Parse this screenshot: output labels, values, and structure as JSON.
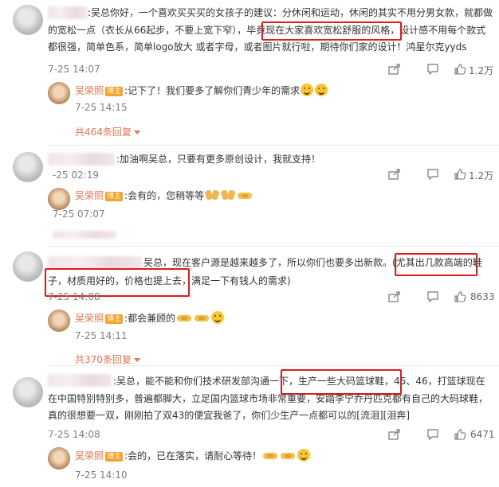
{
  "comment1": {
    "text_l1": ":吴总你好，一个喜欢买买买的女孩子的建议：分休闲和运动，休闲的其实不用分男女款，就都做",
    "text_l2a": "的宽松一点（衣长从66起步，不要上宽下窄），",
    "text_l2_hl": "毕竟现在大家喜欢宽松舒服的风格，",
    "text_l2b": "设计感不用每个款式",
    "text_l3": "都很强，简单色系，简单logo放大 或者字母，或者图片就行啦，期待你们家的设计！鸿星尔克yyds",
    "time": "7-25 14:07",
    "likes": "1.2万",
    "reply": {
      "name": "吴荣照",
      "badge": "博主",
      "text": ":记下了！我们要多了解你们青少年的需求",
      "time": "7-25 14:15"
    },
    "more": "共464条回复"
  },
  "comment2": {
    "text": ":加油啊吴总，只要有更多原创设计，我就支持！",
    "time": "-25 02:19",
    "likes": "1.2万",
    "reply": {
      "name": "吴荣照",
      "badge": "博主",
      "text": ":会有的，您稍等等",
      "time": "7-25 07:07"
    }
  },
  "comment3": {
    "text_l1a": "吴总，现在客户源是越来越多了，所以你们也要多出新款。",
    "text_l1_hl": "(尤其出几款高端的鞋",
    "text_l2_hl1": "子，",
    "text_l2_hl2": "材质用好的，价格也提上去，",
    "text_l2b": "满足一下有钱人的需求)",
    "time": "7-25 14:08",
    "likes": "8633",
    "reply": {
      "name": "吴荣照",
      "badge": "博主",
      "text": ":都会兼顾的",
      "time": "7-25 14:11"
    },
    "more": "共370条回复"
  },
  "comment4": {
    "text_l1a": ":吴总，能不能和你们技术研发部沟通一下，",
    "text_l1_hl": "生产一些大码篮球鞋，",
    "text_l1b": "45、46，打篮球现在",
    "text_l2": "在中国特别特别多，普遍都脚大，立足国内篮球市场非常重要，安踏李宁乔丹匹克都有自己的大码球鞋，",
    "text_l3": "真的很想要一双，刚刚拍了双43的便宜我爸了，你们少生产一点都可以的[流泪][泪奔]",
    "time": "7-25 14:08",
    "likes": "6471",
    "reply": {
      "name": "吴荣照",
      "badge": "博主",
      "text": ":会的，已在落实，请耐心等待！",
      "time": "7-25 14:10"
    }
  },
  "colors": {
    "accent": "#eb7350",
    "highlight_box": "#e11c1c",
    "badge": "#f3a22a",
    "meta": "#808080"
  },
  "icons": [
    "share-icon",
    "comment-icon",
    "like-icon",
    "emoji-icon",
    "pray-icon",
    "handshake-icon",
    "dropdown-icon"
  ]
}
